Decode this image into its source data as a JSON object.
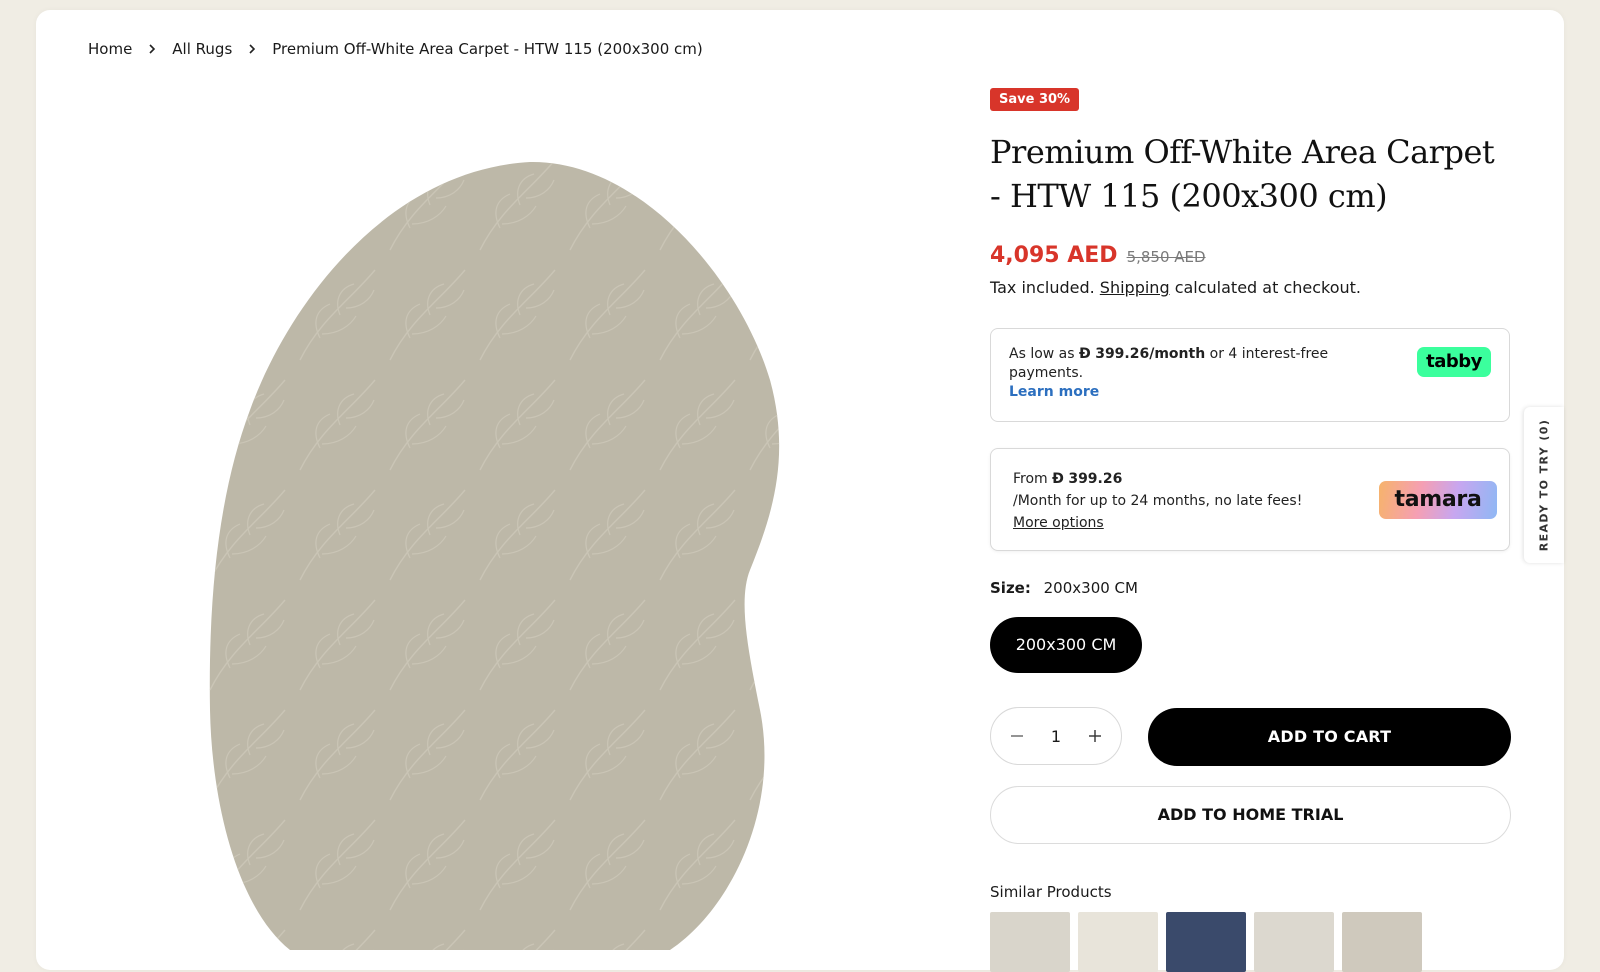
{
  "breadcrumb": {
    "items": [
      {
        "label": "Home"
      },
      {
        "label": "All Rugs"
      },
      {
        "label": "Premium Off-White Area Carpet - HTW 115 (200x300 cm)"
      }
    ]
  },
  "product": {
    "badge": "Save 30%",
    "title": "Premium Off-White Area Carpet - HTW 115 (200x300 cm)",
    "price": "4,095 AED",
    "compare_price": "5,850 AED",
    "tax_prefix": "Tax included.",
    "tax_link": "Shipping",
    "tax_suffix": "calculated at checkout."
  },
  "tabby": {
    "prefix": "As low as",
    "currency_glyph": "Đ",
    "amount": "399.26/month",
    "suffix": "or 4 interest-free payments.",
    "learn_more": "Learn more",
    "logo": "tabby"
  },
  "tamara": {
    "prefix": "From",
    "currency_glyph": "Đ",
    "amount": "399.26",
    "line2": "/Month for up to 24 months, no late fees!",
    "more_options": "More options",
    "logo": "tamara"
  },
  "size": {
    "label": "Size:",
    "selected": "200x300 CM",
    "options": [
      "200x300 CM"
    ]
  },
  "quantity": {
    "value": "1"
  },
  "actions": {
    "add_to_cart": "ADD TO CART",
    "add_to_trial": "ADD TO HOME TRIAL"
  },
  "similar": {
    "label": "Similar Products",
    "thumbs": [
      {
        "color": "#d9d5cb"
      },
      {
        "color": "#e8e4da"
      },
      {
        "color": "#3a4a6b"
      },
      {
        "color": "#dcd8cf"
      },
      {
        "color": "#cfc9bd"
      }
    ]
  },
  "side_tab": {
    "label": "READY TO TRY (0)"
  },
  "colors": {
    "sale": "#d8352a",
    "link_blue": "#2c6fbf",
    "rug": "#bdb8a8",
    "tabby_green": "#3bff9d"
  }
}
